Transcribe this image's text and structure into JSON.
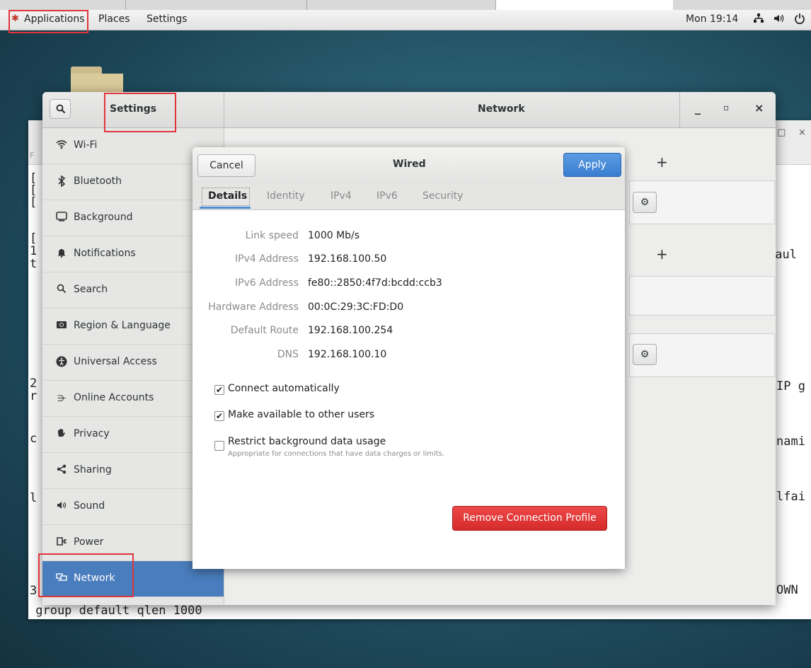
{
  "topbar": {
    "applications": "Applications",
    "places": "Places",
    "settings": "Settings",
    "clock": "Mon 19:14",
    "network_icon": "network-wired-icon",
    "volume_icon": "volume-icon",
    "power_icon": "power-icon"
  },
  "terminal": {
    "tab_label": "F",
    "lines_left": [
      "[",
      "[",
      "[",
      "[",
      "1",
      "t",
      "2",
      "r",
      "c",
      "l",
      "3"
    ],
    "lines_right": [
      "faul",
      "IP g",
      "nami",
      "lfai",
      "OWN"
    ],
    "bottom_line": " group default qlen 1000"
  },
  "settings": {
    "title": "Settings",
    "panel_title": "Network",
    "minimize": "_",
    "maximize": "▫",
    "close": "×",
    "sidebar": [
      {
        "label": "Wi-Fi",
        "icon": "wifi-icon"
      },
      {
        "label": "Bluetooth",
        "icon": "bluetooth-icon"
      },
      {
        "label": "Background",
        "icon": "background-icon"
      },
      {
        "label": "Notifications",
        "icon": "bell-icon"
      },
      {
        "label": "Search",
        "icon": "search-icon"
      },
      {
        "label": "Region & Language",
        "icon": "region-icon"
      },
      {
        "label": "Universal Access",
        "icon": "accessibility-icon"
      },
      {
        "label": "Online Accounts",
        "icon": "online-accounts-icon"
      },
      {
        "label": "Privacy",
        "icon": "hand-icon"
      },
      {
        "label": "Sharing",
        "icon": "share-icon"
      },
      {
        "label": "Sound",
        "icon": "speaker-icon"
      },
      {
        "label": "Power",
        "icon": "power-plug-icon"
      },
      {
        "label": "Network",
        "icon": "network-icon"
      }
    ],
    "selected": "Network"
  },
  "dialog": {
    "cancel": "Cancel",
    "title": "Wired",
    "apply": "Apply",
    "tabs": [
      "Details",
      "Identity",
      "IPv4",
      "IPv6",
      "Security"
    ],
    "active_tab": "Details",
    "details": [
      {
        "label": "Link speed",
        "value": "1000 Mb/s"
      },
      {
        "label": "IPv4 Address",
        "value": "192.168.100.50"
      },
      {
        "label": "IPv6 Address",
        "value": "fe80::2850:4f7d:bcdd:ccb3"
      },
      {
        "label": "Hardware Address",
        "value": "00:0C:29:3C:FD:D0"
      },
      {
        "label": "Default Route",
        "value": "192.168.100.254"
      },
      {
        "label": "DNS",
        "value": "192.168.100.10"
      }
    ],
    "connect_auto": {
      "label": "Connect automatically",
      "checked": true
    },
    "available_users": {
      "label": "Make available to other users",
      "checked": true
    },
    "restrict_bg": {
      "label": "Restrict background data usage",
      "sub": "Appropriate for connections that have data charges or limits.",
      "checked": false
    },
    "remove": "Remove Connection Profile"
  }
}
